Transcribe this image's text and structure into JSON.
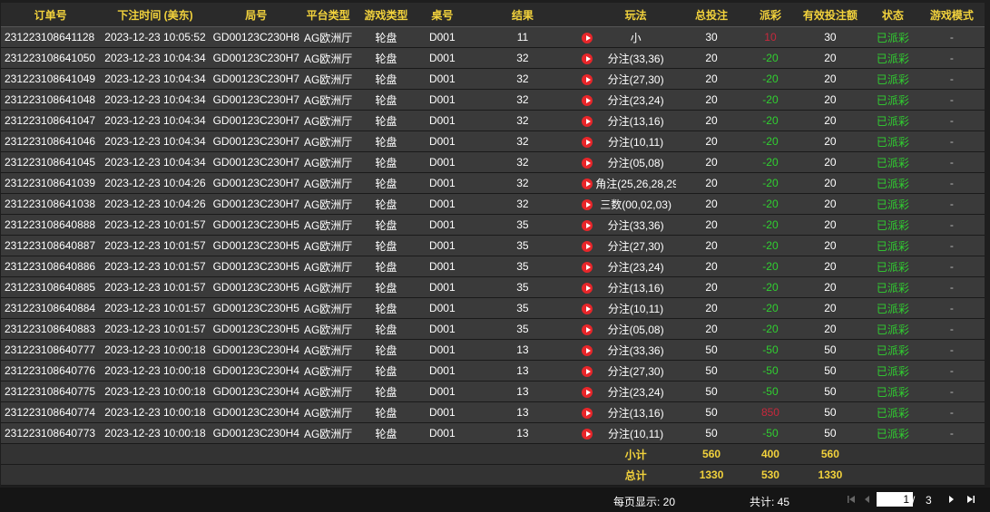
{
  "headers": [
    "订单号",
    "下注时间 (美东)",
    "局号",
    "平台类型",
    "游戏类型",
    "桌号",
    "结果",
    "",
    "玩法",
    "总投注",
    "派彩",
    "有效投注额",
    "状态",
    "游戏模式"
  ],
  "rows": [
    {
      "order": "231223108641128",
      "time": "2023-12-23 10:05:52",
      "round": "GD00123C230H8",
      "platform": "AG欧洲厅",
      "game": "轮盘",
      "table": "D001",
      "result": "11",
      "play": "小",
      "bet": "30",
      "payout": "10",
      "payout_color": "red",
      "valid": "30",
      "status": "已派彩",
      "mode": "-"
    },
    {
      "order": "231223108641050",
      "time": "2023-12-23 10:04:34",
      "round": "GD00123C230H7",
      "platform": "AG欧洲厅",
      "game": "轮盘",
      "table": "D001",
      "result": "32",
      "play": "分注(33,36)",
      "bet": "20",
      "payout": "-20",
      "payout_color": "green",
      "valid": "20",
      "status": "已派彩",
      "mode": "-"
    },
    {
      "order": "231223108641049",
      "time": "2023-12-23 10:04:34",
      "round": "GD00123C230H7",
      "platform": "AG欧洲厅",
      "game": "轮盘",
      "table": "D001",
      "result": "32",
      "play": "分注(27,30)",
      "bet": "20",
      "payout": "-20",
      "payout_color": "green",
      "valid": "20",
      "status": "已派彩",
      "mode": "-"
    },
    {
      "order": "231223108641048",
      "time": "2023-12-23 10:04:34",
      "round": "GD00123C230H7",
      "platform": "AG欧洲厅",
      "game": "轮盘",
      "table": "D001",
      "result": "32",
      "play": "分注(23,24)",
      "bet": "20",
      "payout": "-20",
      "payout_color": "green",
      "valid": "20",
      "status": "已派彩",
      "mode": "-"
    },
    {
      "order": "231223108641047",
      "time": "2023-12-23 10:04:34",
      "round": "GD00123C230H7",
      "platform": "AG欧洲厅",
      "game": "轮盘",
      "table": "D001",
      "result": "32",
      "play": "分注(13,16)",
      "bet": "20",
      "payout": "-20",
      "payout_color": "green",
      "valid": "20",
      "status": "已派彩",
      "mode": "-"
    },
    {
      "order": "231223108641046",
      "time": "2023-12-23 10:04:34",
      "round": "GD00123C230H7",
      "platform": "AG欧洲厅",
      "game": "轮盘",
      "table": "D001",
      "result": "32",
      "play": "分注(10,11)",
      "bet": "20",
      "payout": "-20",
      "payout_color": "green",
      "valid": "20",
      "status": "已派彩",
      "mode": "-"
    },
    {
      "order": "231223108641045",
      "time": "2023-12-23 10:04:34",
      "round": "GD00123C230H7",
      "platform": "AG欧洲厅",
      "game": "轮盘",
      "table": "D001",
      "result": "32",
      "play": "分注(05,08)",
      "bet": "20",
      "payout": "-20",
      "payout_color": "green",
      "valid": "20",
      "status": "已派彩",
      "mode": "-"
    },
    {
      "order": "231223108641039",
      "time": "2023-12-23 10:04:26",
      "round": "GD00123C230H7",
      "platform": "AG欧洲厅",
      "game": "轮盘",
      "table": "D001",
      "result": "32",
      "play": "角注(25,26,28,29)",
      "bet": "20",
      "payout": "-20",
      "payout_color": "green",
      "valid": "20",
      "status": "已派彩",
      "mode": "-"
    },
    {
      "order": "231223108641038",
      "time": "2023-12-23 10:04:26",
      "round": "GD00123C230H7",
      "platform": "AG欧洲厅",
      "game": "轮盘",
      "table": "D001",
      "result": "32",
      "play": "三数(00,02,03)",
      "bet": "20",
      "payout": "-20",
      "payout_color": "green",
      "valid": "20",
      "status": "已派彩",
      "mode": "-"
    },
    {
      "order": "231223108640888",
      "time": "2023-12-23 10:01:57",
      "round": "GD00123C230H5",
      "platform": "AG欧洲厅",
      "game": "轮盘",
      "table": "D001",
      "result": "35",
      "play": "分注(33,36)",
      "bet": "20",
      "payout": "-20",
      "payout_color": "green",
      "valid": "20",
      "status": "已派彩",
      "mode": "-"
    },
    {
      "order": "231223108640887",
      "time": "2023-12-23 10:01:57",
      "round": "GD00123C230H5",
      "platform": "AG欧洲厅",
      "game": "轮盘",
      "table": "D001",
      "result": "35",
      "play": "分注(27,30)",
      "bet": "20",
      "payout": "-20",
      "payout_color": "green",
      "valid": "20",
      "status": "已派彩",
      "mode": "-"
    },
    {
      "order": "231223108640886",
      "time": "2023-12-23 10:01:57",
      "round": "GD00123C230H5",
      "platform": "AG欧洲厅",
      "game": "轮盘",
      "table": "D001",
      "result": "35",
      "play": "分注(23,24)",
      "bet": "20",
      "payout": "-20",
      "payout_color": "green",
      "valid": "20",
      "status": "已派彩",
      "mode": "-"
    },
    {
      "order": "231223108640885",
      "time": "2023-12-23 10:01:57",
      "round": "GD00123C230H5",
      "platform": "AG欧洲厅",
      "game": "轮盘",
      "table": "D001",
      "result": "35",
      "play": "分注(13,16)",
      "bet": "20",
      "payout": "-20",
      "payout_color": "green",
      "valid": "20",
      "status": "已派彩",
      "mode": "-"
    },
    {
      "order": "231223108640884",
      "time": "2023-12-23 10:01:57",
      "round": "GD00123C230H5",
      "platform": "AG欧洲厅",
      "game": "轮盘",
      "table": "D001",
      "result": "35",
      "play": "分注(10,11)",
      "bet": "20",
      "payout": "-20",
      "payout_color": "green",
      "valid": "20",
      "status": "已派彩",
      "mode": "-"
    },
    {
      "order": "231223108640883",
      "time": "2023-12-23 10:01:57",
      "round": "GD00123C230H5",
      "platform": "AG欧洲厅",
      "game": "轮盘",
      "table": "D001",
      "result": "35",
      "play": "分注(05,08)",
      "bet": "20",
      "payout": "-20",
      "payout_color": "green",
      "valid": "20",
      "status": "已派彩",
      "mode": "-"
    },
    {
      "order": "231223108640777",
      "time": "2023-12-23 10:00:18",
      "round": "GD00123C230H4",
      "platform": "AG欧洲厅",
      "game": "轮盘",
      "table": "D001",
      "result": "13",
      "play": "分注(33,36)",
      "bet": "50",
      "payout": "-50",
      "payout_color": "green",
      "valid": "50",
      "status": "已派彩",
      "mode": "-"
    },
    {
      "order": "231223108640776",
      "time": "2023-12-23 10:00:18",
      "round": "GD00123C230H4",
      "platform": "AG欧洲厅",
      "game": "轮盘",
      "table": "D001",
      "result": "13",
      "play": "分注(27,30)",
      "bet": "50",
      "payout": "-50",
      "payout_color": "green",
      "valid": "50",
      "status": "已派彩",
      "mode": "-"
    },
    {
      "order": "231223108640775",
      "time": "2023-12-23 10:00:18",
      "round": "GD00123C230H4",
      "platform": "AG欧洲厅",
      "game": "轮盘",
      "table": "D001",
      "result": "13",
      "play": "分注(23,24)",
      "bet": "50",
      "payout": "-50",
      "payout_color": "green",
      "valid": "50",
      "status": "已派彩",
      "mode": "-"
    },
    {
      "order": "231223108640774",
      "time": "2023-12-23 10:00:18",
      "round": "GD00123C230H4",
      "platform": "AG欧洲厅",
      "game": "轮盘",
      "table": "D001",
      "result": "13",
      "play": "分注(13,16)",
      "bet": "50",
      "payout": "850",
      "payout_color": "red",
      "valid": "50",
      "status": "已派彩",
      "mode": "-"
    },
    {
      "order": "231223108640773",
      "time": "2023-12-23 10:00:18",
      "round": "GD00123C230H4",
      "platform": "AG欧洲厅",
      "game": "轮盘",
      "table": "D001",
      "result": "13",
      "play": "分注(10,11)",
      "bet": "50",
      "payout": "-50",
      "payout_color": "green",
      "valid": "50",
      "status": "已派彩",
      "mode": "-"
    }
  ],
  "subtotal": {
    "label": "小计",
    "bet": "560",
    "payout": "400",
    "valid": "560"
  },
  "total": {
    "label": "总计",
    "bet": "1330",
    "payout": "530",
    "valid": "1330"
  },
  "pager": {
    "per_page": "每页显示: 20",
    "count": "共计: 45",
    "current_page": "1",
    "separator": "/",
    "total_pages": "3"
  },
  "colors": {
    "header": "#f2d23c",
    "win": "#c8283c",
    "loss": "#30d030",
    "row_bg": "#3a3a3a",
    "play_icon": "#e8262a"
  },
  "icons": {
    "row_action": "play-circle-icon",
    "first": "first-page-icon",
    "prev": "prev-page-icon",
    "next": "next-page-icon",
    "last": "last-page-icon"
  }
}
